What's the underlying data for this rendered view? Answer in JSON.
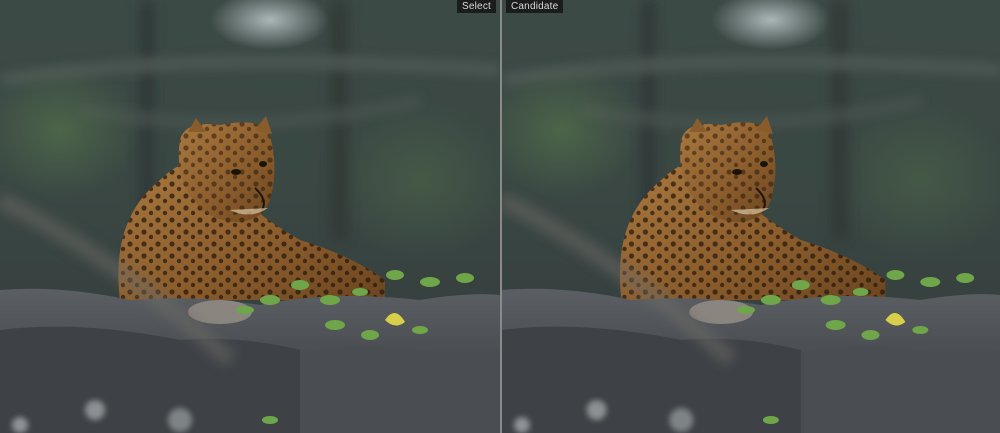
{
  "compare_view": {
    "select_label": "Select",
    "candidate_label": "Candidate"
  },
  "colors": {
    "divider": "#8a8a8a",
    "label_bg": "#141414",
    "label_text": "#d9d9d9"
  },
  "image": {
    "subject": "leopard resting on rocks in forest"
  }
}
